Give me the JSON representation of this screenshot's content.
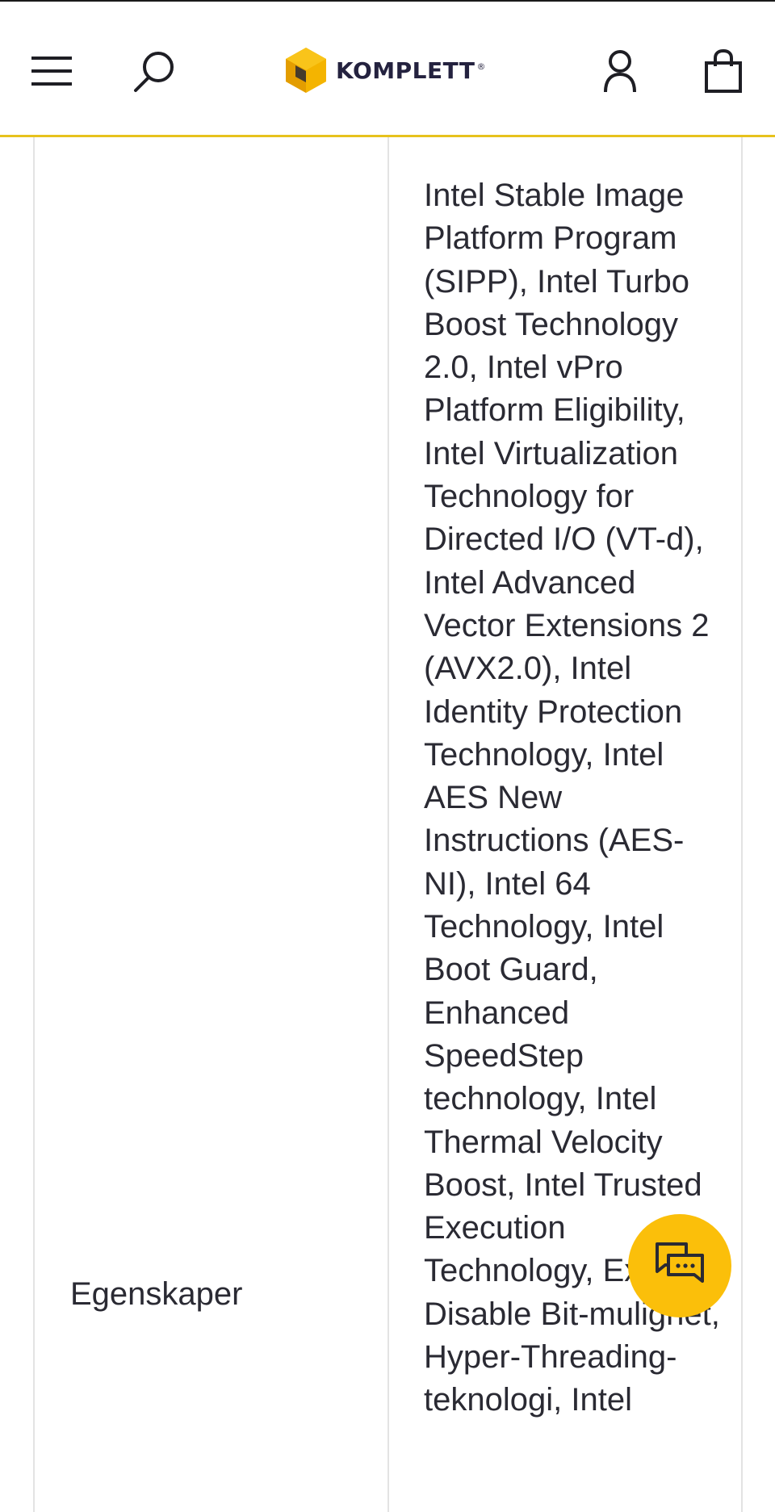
{
  "header": {
    "menu_icon": "hamburger-menu-icon",
    "search_icon": "search-icon",
    "logo_text": "KOMPLETT",
    "logo_registered": "®",
    "account_icon": "user-icon",
    "cart_icon": "shopping-bag-icon",
    "accent_color": "#e7c21d"
  },
  "spec_row": {
    "label": "Egenskaper",
    "value": "Intel Stable Image Platform Program (SIPP), Intel Turbo Boost Technology 2.0, Intel vPro Platform Eligibility, Intel Virtualization Technology for Directed I/O (VT-d), Intel Advanced Vector Extensions 2 (AVX2.0), Intel Identity Protection Technology, Intel AES New Instructions (AES-NI), Intel 64 Technology, Intel Boot Guard, Enhanced SpeedStep technology, Intel Thermal Velocity Boost, Intel Trusted Execution Technology, Execute Disable Bit-mulighet, Hyper-Threading-teknologi, Intel"
  },
  "chat": {
    "icon": "chat-bubbles-icon",
    "color": "#fbbf0a"
  }
}
